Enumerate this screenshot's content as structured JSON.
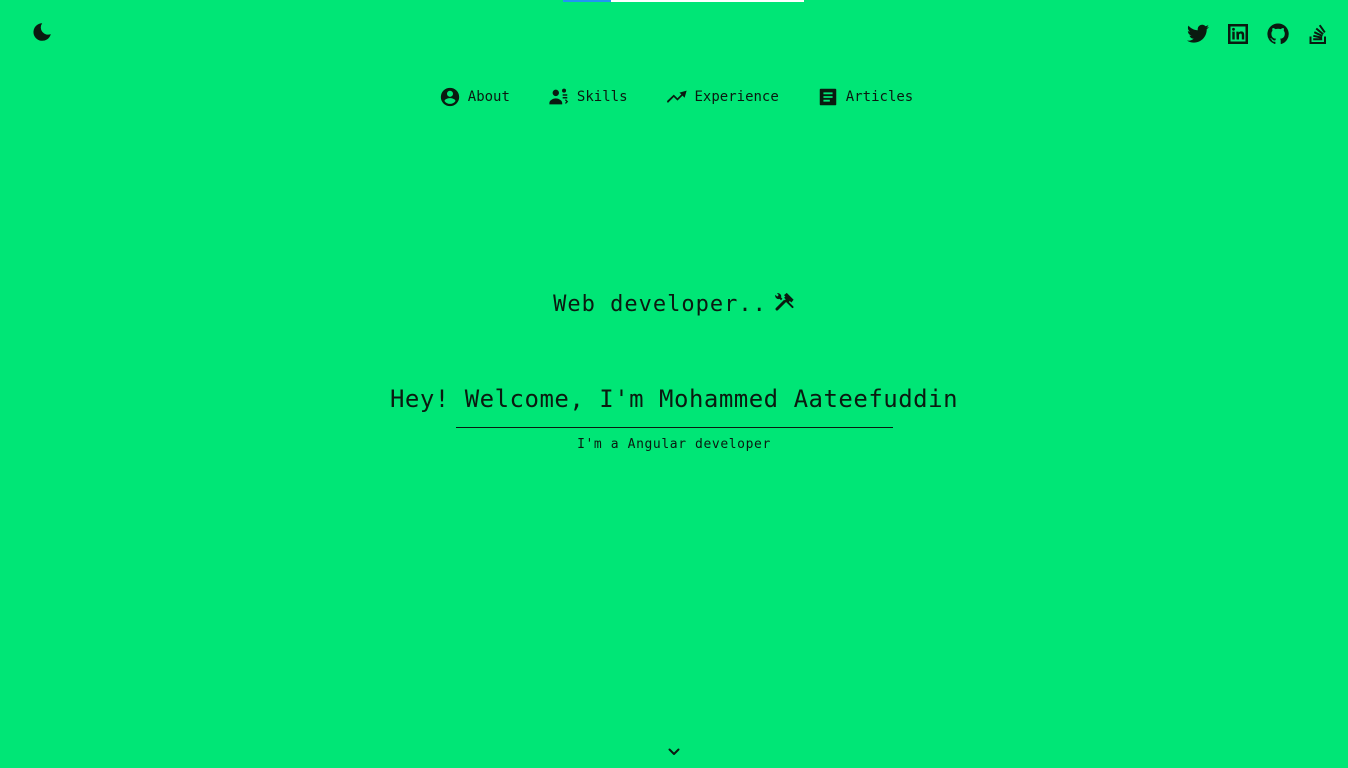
{
  "progress": {
    "fraction": 0.2
  },
  "theme_toggle": {
    "icon": "moon-icon"
  },
  "social": [
    {
      "name": "Twitter",
      "icon": "twitter-icon"
    },
    {
      "name": "LinkedIn",
      "icon": "linkedin-icon"
    },
    {
      "name": "GitHub",
      "icon": "github-icon"
    },
    {
      "name": "Stack Overflow",
      "icon": "stackoverflow-icon"
    }
  ],
  "nav": {
    "items": [
      {
        "label": "About",
        "icon": "account-circle-icon"
      },
      {
        "label": "Skills",
        "icon": "people-icon"
      },
      {
        "label": "Experience",
        "icon": "trending-up-icon"
      },
      {
        "label": "Articles",
        "icon": "article-icon"
      }
    ]
  },
  "hero": {
    "tagline": "Web developer..",
    "tagline_icon": "hammer-wrench-icon",
    "welcome": "Hey! Welcome, I'm Mohammed Aateefuddin",
    "subtitle": "I'm a Angular developer"
  },
  "scroll": {
    "icon": "chevron-down-icon"
  },
  "colors": {
    "background": "#00E676",
    "text": "#0a1a10",
    "progress_fill": "#2196f3",
    "progress_track": "#ffffff"
  }
}
